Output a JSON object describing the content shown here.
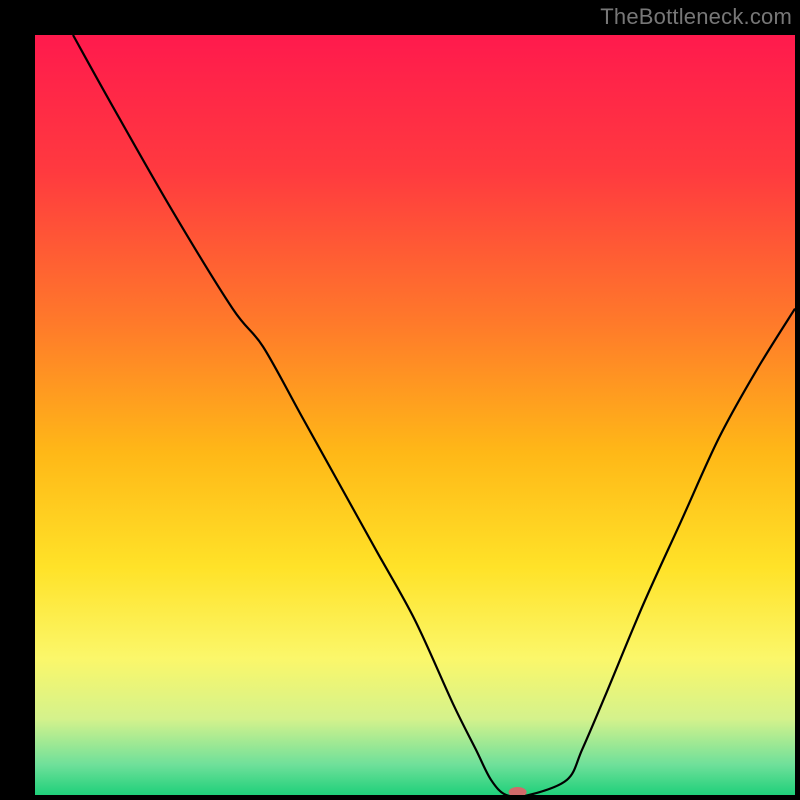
{
  "attribution": "TheBottleneck.com",
  "chart_data": {
    "type": "line",
    "title": "",
    "xlabel": "",
    "ylabel": "",
    "xlim": [
      0,
      100
    ],
    "ylim": [
      0,
      100
    ],
    "background_gradient": {
      "stops": [
        {
          "offset": 0,
          "color": "#ff1a4d"
        },
        {
          "offset": 0.18,
          "color": "#ff3a3f"
        },
        {
          "offset": 0.38,
          "color": "#ff7a2a"
        },
        {
          "offset": 0.55,
          "color": "#ffb817"
        },
        {
          "offset": 0.7,
          "color": "#ffe228"
        },
        {
          "offset": 0.82,
          "color": "#fbf76a"
        },
        {
          "offset": 0.9,
          "color": "#d4f28c"
        },
        {
          "offset": 0.96,
          "color": "#6fe09a"
        },
        {
          "offset": 1.0,
          "color": "#1fd07a"
        }
      ]
    },
    "series": [
      {
        "name": "bottleneck-curve",
        "color": "#000000",
        "width": 2.2,
        "x": [
          5,
          10,
          18,
          26,
          30,
          35,
          40,
          45,
          50,
          55,
          58,
          60,
          62,
          65,
          70,
          72,
          75,
          80,
          85,
          90,
          95,
          100
        ],
        "y": [
          100,
          91,
          77,
          64,
          59,
          50,
          41,
          32,
          23,
          12,
          6,
          2,
          0,
          0,
          2,
          6,
          13,
          25,
          36,
          47,
          56,
          64
        ]
      }
    ],
    "marker": {
      "name": "optimal-point",
      "x": 63.5,
      "y": 0,
      "rx": 9,
      "ry": 5,
      "color": "#d06a6a"
    }
  }
}
